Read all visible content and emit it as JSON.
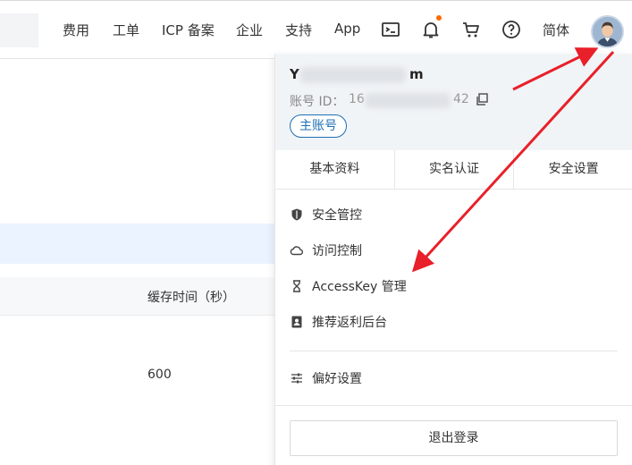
{
  "nav": {
    "items": [
      "费用",
      "工单",
      "ICP 备案",
      "企业",
      "支持",
      "App",
      "简体"
    ],
    "icons": [
      "terminal-icon",
      "bell-icon",
      "cart-icon",
      "help-icon"
    ],
    "notification_dot_color": "#ff6a00"
  },
  "background": {
    "column_header": "缓存时间（秒）",
    "cell_value": "600"
  },
  "account": {
    "name_prefix": "Y",
    "name_suffix": "m",
    "id_label": "账号 ID：",
    "id_prefix": "16",
    "id_suffix": "42",
    "tag": "主账号"
  },
  "tabs": [
    "基本资料",
    "实名认证",
    "安全设置"
  ],
  "menu": [
    {
      "label": "安全管控",
      "icon": "shield-icon"
    },
    {
      "label": "访问控制",
      "icon": "cloud-icon"
    },
    {
      "label": "AccessKey 管理",
      "icon": "key-icon"
    },
    {
      "label": "推荐返利后台",
      "icon": "rebate-icon"
    }
  ],
  "preferences": {
    "label": "偏好设置",
    "icon": "sliders-icon"
  },
  "logout_label": "退出登录",
  "colors": {
    "accent": "#1f6fb5",
    "annotation_arrow": "#e8202a",
    "selected_row": "#eaf3ff"
  }
}
